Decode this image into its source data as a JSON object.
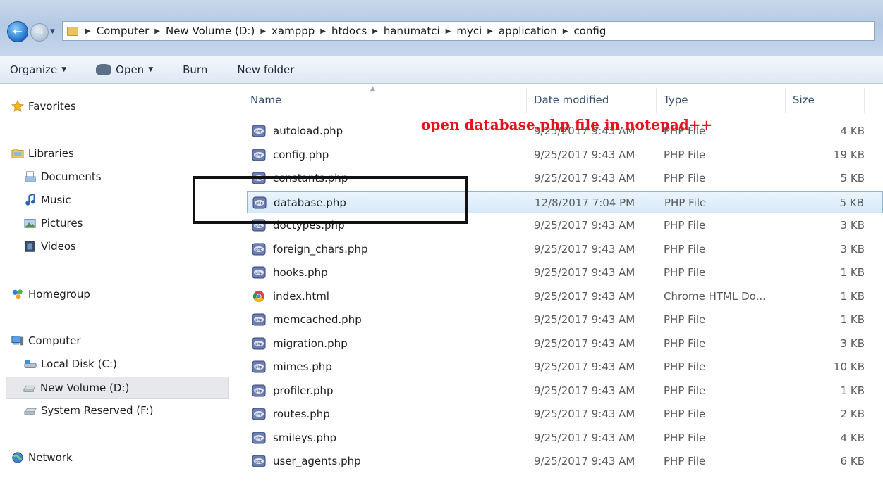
{
  "address_bar": {
    "crumbs": [
      "Computer",
      "New Volume (D:)",
      "xamppp",
      "htdocs",
      "hanumatci",
      "myci",
      "application",
      "config"
    ]
  },
  "toolbar": {
    "organize": "Organize",
    "open": "Open",
    "burn": "Burn",
    "new_folder": "New folder"
  },
  "sidebar": {
    "favorites": "Favorites",
    "libraries": "Libraries",
    "documents": "Documents",
    "music": "Music",
    "pictures": "Pictures",
    "videos": "Videos",
    "homegroup": "Homegroup",
    "computer": "Computer",
    "local_disk": "Local Disk (C:)",
    "new_volume": "New Volume (D:)",
    "system_reserved": "System Reserved (F:)",
    "network": "Network"
  },
  "columns": {
    "name": "Name",
    "date": "Date modified",
    "type": "Type",
    "size": "Size"
  },
  "files": [
    {
      "name": "autoload.php",
      "date": "9/25/2017 9:43 AM",
      "type": "PHP File",
      "size": "4 KB",
      "icon": "php-file-icon"
    },
    {
      "name": "config.php",
      "date": "9/25/2017 9:43 AM",
      "type": "PHP File",
      "size": "19 KB",
      "icon": "php-file-icon"
    },
    {
      "name": "constants.php",
      "date": "9/25/2017 9:43 AM",
      "type": "PHP File",
      "size": "5 KB",
      "icon": "php-file-icon"
    },
    {
      "name": "database.php",
      "date": "12/8/2017 7:04 PM",
      "type": "PHP File",
      "size": "5 KB",
      "icon": "php-file-icon",
      "selected": true
    },
    {
      "name": "doctypes.php",
      "date": "9/25/2017 9:43 AM",
      "type": "PHP File",
      "size": "3 KB",
      "icon": "php-file-icon"
    },
    {
      "name": "foreign_chars.php",
      "date": "9/25/2017 9:43 AM",
      "type": "PHP File",
      "size": "3 KB",
      "icon": "php-file-icon"
    },
    {
      "name": "hooks.php",
      "date": "9/25/2017 9:43 AM",
      "type": "PHP File",
      "size": "1 KB",
      "icon": "php-file-icon"
    },
    {
      "name": "index.html",
      "date": "9/25/2017 9:43 AM",
      "type": "Chrome HTML Do...",
      "size": "1 KB",
      "icon": "chrome-icon"
    },
    {
      "name": "memcached.php",
      "date": "9/25/2017 9:43 AM",
      "type": "PHP File",
      "size": "1 KB",
      "icon": "php-file-icon"
    },
    {
      "name": "migration.php",
      "date": "9/25/2017 9:43 AM",
      "type": "PHP File",
      "size": "3 KB",
      "icon": "php-file-icon"
    },
    {
      "name": "mimes.php",
      "date": "9/25/2017 9:43 AM",
      "type": "PHP File",
      "size": "10 KB",
      "icon": "php-file-icon"
    },
    {
      "name": "profiler.php",
      "date": "9/25/2017 9:43 AM",
      "type": "PHP File",
      "size": "1 KB",
      "icon": "php-file-icon"
    },
    {
      "name": "routes.php",
      "date": "9/25/2017 9:43 AM",
      "type": "PHP File",
      "size": "2 KB",
      "icon": "php-file-icon"
    },
    {
      "name": "smileys.php",
      "date": "9/25/2017 9:43 AM",
      "type": "PHP File",
      "size": "4 KB",
      "icon": "php-file-icon"
    },
    {
      "name": "user_agents.php",
      "date": "9/25/2017 9:43 AM",
      "type": "PHP File",
      "size": "6 KB",
      "icon": "php-file-icon"
    }
  ],
  "annotation": {
    "text": "open database.php file in notepad++",
    "color": "#e8101c"
  },
  "colors": {
    "selection": "#d7eaf9",
    "selection_border": "#87b8e2"
  }
}
